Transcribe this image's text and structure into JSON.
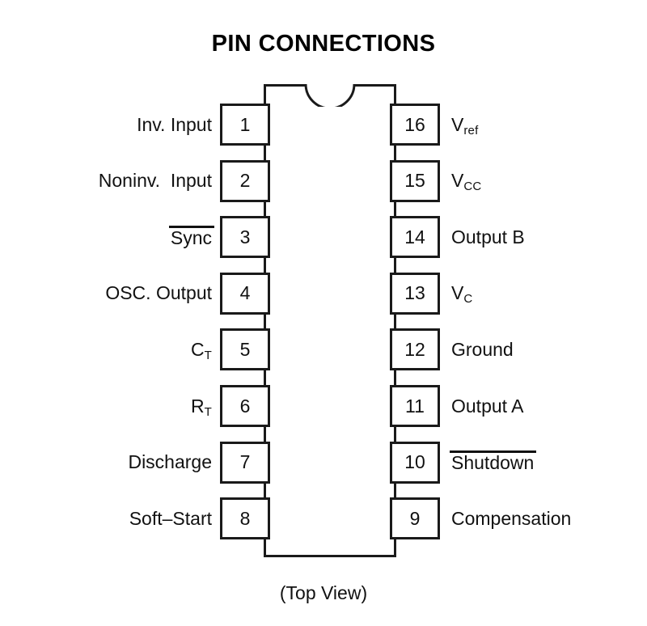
{
  "title": "PIN CONNECTIONS",
  "caption": "(Top View)",
  "package": {
    "notch_icon": "package-notch-icon",
    "body_label": "chip-body"
  },
  "colors": {
    "outline": "#1a1a1a",
    "text": "#111111",
    "background": "#ffffff"
  },
  "pins": {
    "left": [
      {
        "number": "1",
        "label": "Inv. Input",
        "overline": false,
        "sub": ""
      },
      {
        "number": "2",
        "label": "Noninv.  Input",
        "overline": false,
        "sub": ""
      },
      {
        "number": "3",
        "label": "Sync",
        "overline": true,
        "sub": ""
      },
      {
        "number": "4",
        "label": "OSC. Output",
        "overline": false,
        "sub": ""
      },
      {
        "number": "5",
        "label": "C",
        "overline": false,
        "sub": "T"
      },
      {
        "number": "6",
        "label": "R",
        "overline": false,
        "sub": "T"
      },
      {
        "number": "7",
        "label": "Discharge",
        "overline": false,
        "sub": ""
      },
      {
        "number": "8",
        "label": "Soft–Start",
        "overline": false,
        "sub": ""
      }
    ],
    "right": [
      {
        "number": "16",
        "label": "V",
        "overline": false,
        "sub": "ref"
      },
      {
        "number": "15",
        "label": "V",
        "overline": false,
        "sub": "CC"
      },
      {
        "number": "14",
        "label": "Output B",
        "overline": false,
        "sub": ""
      },
      {
        "number": "13",
        "label": "V",
        "overline": false,
        "sub": "C"
      },
      {
        "number": "12",
        "label": "Ground",
        "overline": false,
        "sub": ""
      },
      {
        "number": "11",
        "label": "Output A",
        "overline": false,
        "sub": ""
      },
      {
        "number": "10",
        "label": "Shutdown",
        "overline": true,
        "sub": ""
      },
      {
        "number": "9",
        "label": "Compensation",
        "overline": false,
        "sub": ""
      }
    ]
  }
}
